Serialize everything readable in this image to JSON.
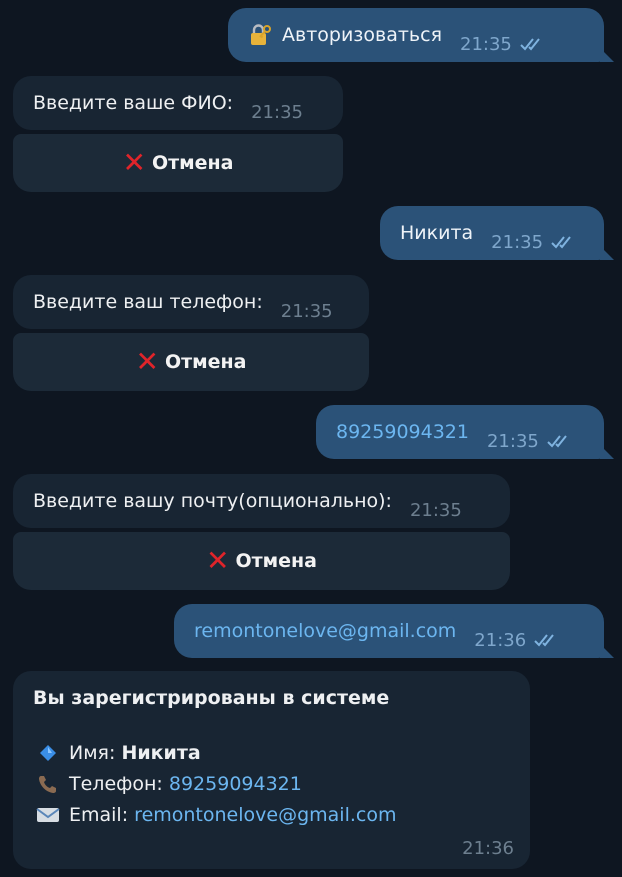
{
  "messages": {
    "m1": {
      "icon": "lock-with-key-icon",
      "text": "Авторизоваться",
      "time": "21:35"
    },
    "m2": {
      "text": "Введите ваше ФИО:",
      "time": "21:35",
      "button": "Отмена"
    },
    "m3": {
      "text": "Никита",
      "time": "21:35"
    },
    "m4": {
      "text": "Введите ваш телефон:",
      "time": "21:35",
      "button": "Отмена"
    },
    "m5": {
      "text": "89259094321",
      "time": "21:35"
    },
    "m6": {
      "text": "Введите вашу почту(опционально):",
      "time": "21:35",
      "button": "Отмена"
    },
    "m7": {
      "text": "remontonelove@gmail.com",
      "time": "21:36"
    }
  },
  "card": {
    "title": "Вы зарегистрированы в системе",
    "name_label": "Имя:",
    "name_value": "Никита",
    "phone_label": "Телефон:",
    "phone_value": "89259094321",
    "email_label": "Email:",
    "email_value": "remontonelove@gmail.com",
    "time": "21:36"
  },
  "colors": {
    "background": "#0e1621",
    "outgoing_bubble": "#2b5278",
    "incoming_bubble": "#182533",
    "link": "#6cb6f0",
    "cancel_icon": "#e0242a"
  }
}
